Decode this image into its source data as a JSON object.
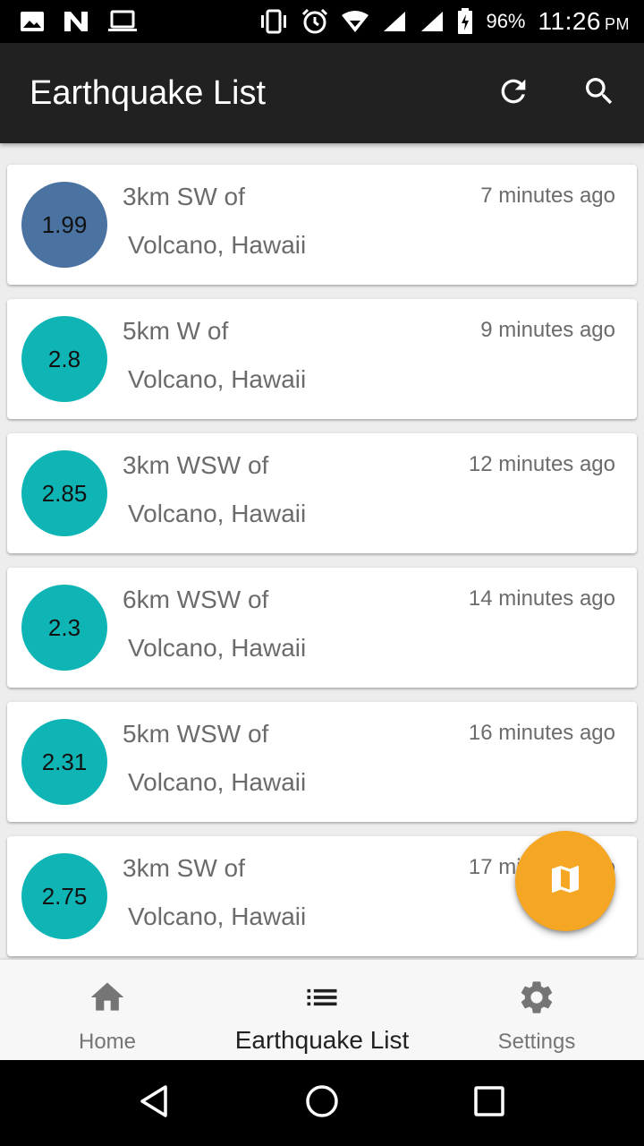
{
  "status_bar": {
    "icons_left": [
      "image-icon",
      "n-icon",
      "laptop-icon"
    ],
    "icons_right": [
      "vibrate-icon",
      "alarm-icon",
      "wifi-icon",
      "signal-icon",
      "signal-icon",
      "battery-charging-icon"
    ],
    "battery": "96%",
    "time": "11:26",
    "ampm": "PM"
  },
  "appbar": {
    "title": "Earthquake List",
    "actions": [
      "refresh-icon",
      "search-icon"
    ]
  },
  "earthquakes": [
    {
      "mag": "1.99",
      "offset": "3km SW of",
      "place": "Volcano, Hawaii",
      "time": "7 minutes ago",
      "color": "#4a73a1"
    },
    {
      "mag": "2.8",
      "offset": "5km W of",
      "place": "Volcano, Hawaii",
      "time": "9 minutes ago",
      "color": "#0fb5b5"
    },
    {
      "mag": "2.85",
      "offset": "3km WSW of",
      "place": "Volcano, Hawaii",
      "time": "12 minutes ago",
      "color": "#0fb5b5"
    },
    {
      "mag": "2.3",
      "offset": "6km WSW of",
      "place": "Volcano, Hawaii",
      "time": "14 minutes ago",
      "color": "#0fb5b5"
    },
    {
      "mag": "2.31",
      "offset": "5km WSW of",
      "place": "Volcano, Hawaii",
      "time": "16 minutes ago",
      "color": "#0fb5b5"
    },
    {
      "mag": "2.75",
      "offset": "3km SW of",
      "place": "Volcano, Hawaii",
      "time": "17 minutes ago",
      "color": "#0fb5b5"
    }
  ],
  "fab": {
    "icon": "map-icon",
    "color": "#f5a623"
  },
  "bottom_nav": {
    "items": [
      {
        "label": "Home",
        "icon": "home-icon"
      },
      {
        "label": "Earthquake List",
        "icon": "list-icon",
        "active": true
      },
      {
        "label": "Settings",
        "icon": "gear-icon"
      }
    ]
  },
  "system_nav": [
    "back-icon",
    "home-circle-icon",
    "recents-icon"
  ]
}
